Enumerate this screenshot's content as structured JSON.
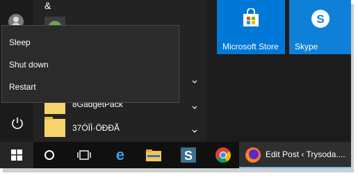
{
  "start_menu": {
    "top_app_letter": "&",
    "apps": [
      {
        "label": "8GadgetPack",
        "icon": "folder-icon"
      },
      {
        "label": "37ÓÏÌ·ÖÐÐÃ",
        "icon": "folder-icon"
      }
    ]
  },
  "power_menu": {
    "items": [
      {
        "label": "Sleep"
      },
      {
        "label": "Shut down"
      },
      {
        "label": "Restart"
      }
    ]
  },
  "tiles": [
    {
      "label": "Microsoft Store",
      "icon": "store-icon",
      "color": "#0078d7"
    },
    {
      "label": "Skype",
      "icon": "skype-icon",
      "color": "#0f80d8"
    }
  ],
  "taskbar": {
    "items": [
      {
        "icon": "windows-start-icon"
      },
      {
        "icon": "cortana-search-icon"
      },
      {
        "icon": "task-view-icon"
      },
      {
        "icon": "edge-icon"
      },
      {
        "icon": "file-explorer-icon"
      },
      {
        "icon": "snagit-icon"
      },
      {
        "icon": "chrome-icon"
      },
      {
        "icon": "firefox-icon",
        "label": "Edit Post ‹ Trysoda...."
      }
    ]
  }
}
